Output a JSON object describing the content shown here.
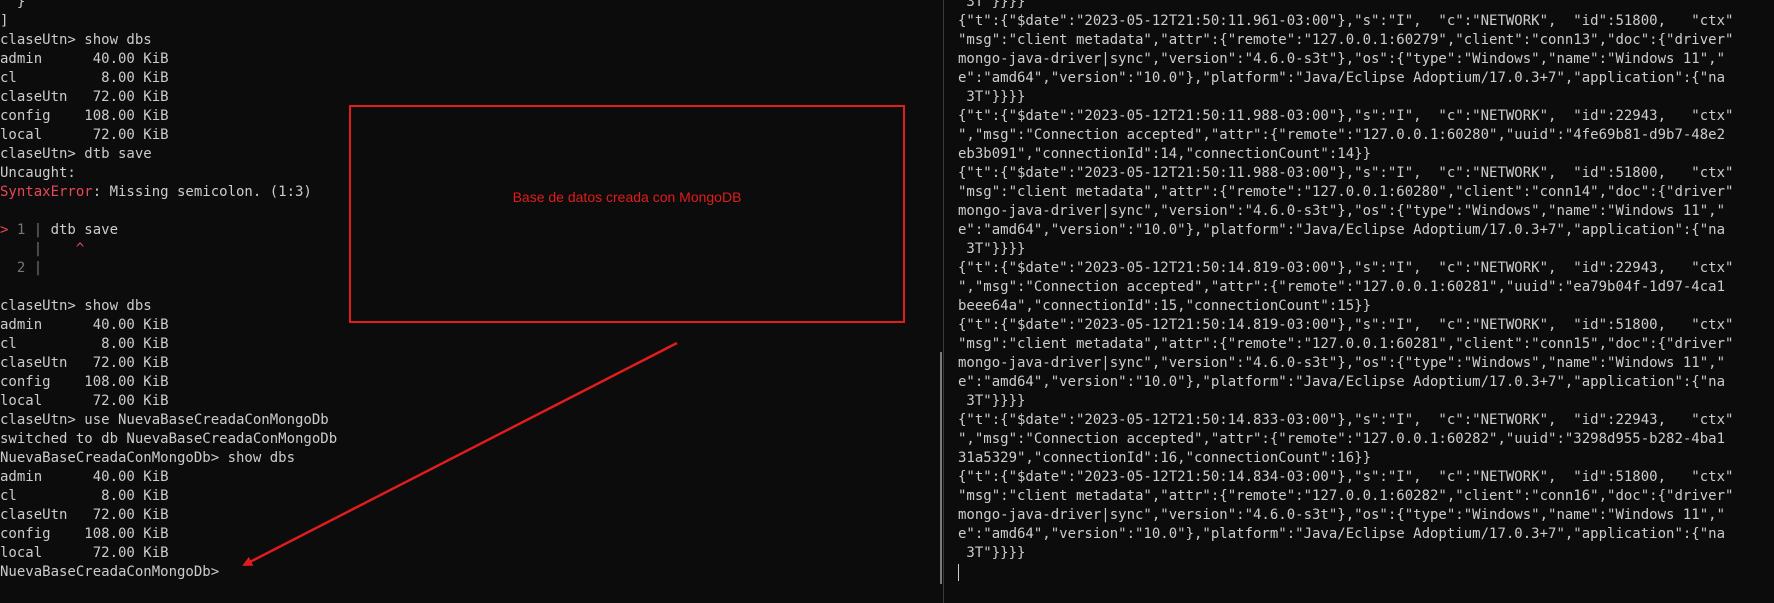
{
  "left_terminal": {
    "lines": [
      {
        "segments": [
          {
            "t": "  }",
            "c": ""
          }
        ]
      },
      {
        "segments": [
          {
            "t": "]",
            "c": ""
          }
        ]
      },
      {
        "segments": [
          {
            "t": "claseUtn> show dbs",
            "c": ""
          }
        ]
      },
      {
        "segments": [
          {
            "t": "admin      40.00 KiB",
            "c": ""
          }
        ]
      },
      {
        "segments": [
          {
            "t": "cl          8.00 KiB",
            "c": ""
          }
        ]
      },
      {
        "segments": [
          {
            "t": "claseUtn   72.00 KiB",
            "c": ""
          }
        ]
      },
      {
        "segments": [
          {
            "t": "config    108.00 KiB",
            "c": ""
          }
        ]
      },
      {
        "segments": [
          {
            "t": "local      72.00 KiB",
            "c": ""
          }
        ]
      },
      {
        "segments": [
          {
            "t": "claseUtn> dtb save",
            "c": ""
          }
        ]
      },
      {
        "segments": [
          {
            "t": "Uncaught:",
            "c": ""
          }
        ]
      },
      {
        "segments": [
          {
            "t": "SyntaxError",
            "c": "err"
          },
          {
            "t": ": Missing semicolon. (1:3)",
            "c": ""
          }
        ]
      },
      {
        "segments": [
          {
            "t": "",
            "c": ""
          }
        ]
      },
      {
        "segments": [
          {
            "t": "> ",
            "c": "err"
          },
          {
            "t": "1 | ",
            "c": "dim"
          },
          {
            "t": "dtb save",
            "c": ""
          }
        ]
      },
      {
        "segments": [
          {
            "t": "    | ",
            "c": "dim"
          },
          {
            "t": "   ^",
            "c": "err"
          }
        ]
      },
      {
        "segments": [
          {
            "t": "  2 | ",
            "c": "dim"
          }
        ]
      },
      {
        "segments": [
          {
            "t": "",
            "c": ""
          }
        ]
      },
      {
        "segments": [
          {
            "t": "claseUtn> show dbs",
            "c": ""
          }
        ]
      },
      {
        "segments": [
          {
            "t": "admin      40.00 KiB",
            "c": ""
          }
        ]
      },
      {
        "segments": [
          {
            "t": "cl          8.00 KiB",
            "c": ""
          }
        ]
      },
      {
        "segments": [
          {
            "t": "claseUtn   72.00 KiB",
            "c": ""
          }
        ]
      },
      {
        "segments": [
          {
            "t": "config    108.00 KiB",
            "c": ""
          }
        ]
      },
      {
        "segments": [
          {
            "t": "local      72.00 KiB",
            "c": ""
          }
        ]
      },
      {
        "segments": [
          {
            "t": "claseUtn> use NuevaBaseCreadaConMongoDb",
            "c": ""
          }
        ]
      },
      {
        "segments": [
          {
            "t": "switched to db NuevaBaseCreadaConMongoDb",
            "c": ""
          }
        ]
      },
      {
        "segments": [
          {
            "t": "NuevaBaseCreadaConMongoDb> show dbs",
            "c": ""
          }
        ]
      },
      {
        "segments": [
          {
            "t": "admin      40.00 KiB",
            "c": ""
          }
        ]
      },
      {
        "segments": [
          {
            "t": "cl          8.00 KiB",
            "c": ""
          }
        ]
      },
      {
        "segments": [
          {
            "t": "claseUtn   72.00 KiB",
            "c": ""
          }
        ]
      },
      {
        "segments": [
          {
            "t": "config    108.00 KiB",
            "c": ""
          }
        ]
      },
      {
        "segments": [
          {
            "t": "local      72.00 KiB",
            "c": ""
          }
        ]
      },
      {
        "segments": [
          {
            "t": "NuevaBaseCreadaConMongoDb>",
            "c": ""
          }
        ]
      }
    ]
  },
  "right_terminal": {
    "lines": [
      " 3T\"}}}}",
      "{\"t\":{\"$date\":\"2023-05-12T21:50:11.961-03:00\"},\"s\":\"I\",  \"c\":\"NETWORK\",  \"id\":51800,   \"ctx\"",
      "\"msg\":\"client metadata\",\"attr\":{\"remote\":\"127.0.0.1:60279\",\"client\":\"conn13\",\"doc\":{\"driver\"",
      "mongo-java-driver|sync\",\"version\":\"4.6.0-s3t\"},\"os\":{\"type\":\"Windows\",\"name\":\"Windows 11\",\"",
      "e\":\"amd64\",\"version\":\"10.0\"},\"platform\":\"Java/Eclipse Adoptium/17.0.3+7\",\"application\":{\"na",
      " 3T\"}}}}",
      "{\"t\":{\"$date\":\"2023-05-12T21:50:11.988-03:00\"},\"s\":\"I\",  \"c\":\"NETWORK\",  \"id\":22943,   \"ctx\"",
      "\",\"msg\":\"Connection accepted\",\"attr\":{\"remote\":\"127.0.0.1:60280\",\"uuid\":\"4fe69b81-d9b7-48e2",
      "eb3b091\",\"connectionId\":14,\"connectionCount\":14}}",
      "{\"t\":{\"$date\":\"2023-05-12T21:50:11.988-03:00\"},\"s\":\"I\",  \"c\":\"NETWORK\",  \"id\":51800,   \"ctx\"",
      "\"msg\":\"client metadata\",\"attr\":{\"remote\":\"127.0.0.1:60280\",\"client\":\"conn14\",\"doc\":{\"driver\"",
      "mongo-java-driver|sync\",\"version\":\"4.6.0-s3t\"},\"os\":{\"type\":\"Windows\",\"name\":\"Windows 11\",\"",
      "e\":\"amd64\",\"version\":\"10.0\"},\"platform\":\"Java/Eclipse Adoptium/17.0.3+7\",\"application\":{\"na",
      " 3T\"}}}}",
      "{\"t\":{\"$date\":\"2023-05-12T21:50:14.819-03:00\"},\"s\":\"I\",  \"c\":\"NETWORK\",  \"id\":22943,   \"ctx\"",
      "\",\"msg\":\"Connection accepted\",\"attr\":{\"remote\":\"127.0.0.1:60281\",\"uuid\":\"ea79b04f-1d97-4ca1",
      "beee64a\",\"connectionId\":15,\"connectionCount\":15}}",
      "{\"t\":{\"$date\":\"2023-05-12T21:50:14.819-03:00\"},\"s\":\"I\",  \"c\":\"NETWORK\",  \"id\":51800,   \"ctx\"",
      "\"msg\":\"client metadata\",\"attr\":{\"remote\":\"127.0.0.1:60281\",\"client\":\"conn15\",\"doc\":{\"driver\"",
      "mongo-java-driver|sync\",\"version\":\"4.6.0-s3t\"},\"os\":{\"type\":\"Windows\",\"name\":\"Windows 11\",\"",
      "e\":\"amd64\",\"version\":\"10.0\"},\"platform\":\"Java/Eclipse Adoptium/17.0.3+7\",\"application\":{\"na",
      " 3T\"}}}}",
      "{\"t\":{\"$date\":\"2023-05-12T21:50:14.833-03:00\"},\"s\":\"I\",  \"c\":\"NETWORK\",  \"id\":22943,   \"ctx\"",
      "\",\"msg\":\"Connection accepted\",\"attr\":{\"remote\":\"127.0.0.1:60282\",\"uuid\":\"3298d955-b282-4ba1",
      "31a5329\",\"connectionId\":16,\"connectionCount\":16}}",
      "{\"t\":{\"$date\":\"2023-05-12T21:50:14.834-03:00\"},\"s\":\"I\",  \"c\":\"NETWORK\",  \"id\":51800,   \"ctx\"",
      "\"msg\":\"client metadata\",\"attr\":{\"remote\":\"127.0.0.1:60282\",\"client\":\"conn16\",\"doc\":{\"driver\"",
      "mongo-java-driver|sync\",\"version\":\"4.6.0-s3t\"},\"os\":{\"type\":\"Windows\",\"name\":\"Windows 11\",\"",
      "e\":\"amd64\",\"version\":\"10.0\"},\"platform\":\"Java/Eclipse Adoptium/17.0.3+7\",\"application\":{\"na",
      " 3T\"}}}}",
      ""
    ]
  },
  "annotation": {
    "label": "Base de datos creada con MongoDB",
    "color": "#e11c1c"
  },
  "colors": {
    "background": "#0c0c0c",
    "text": "#cccccc",
    "error": "#e74856"
  }
}
